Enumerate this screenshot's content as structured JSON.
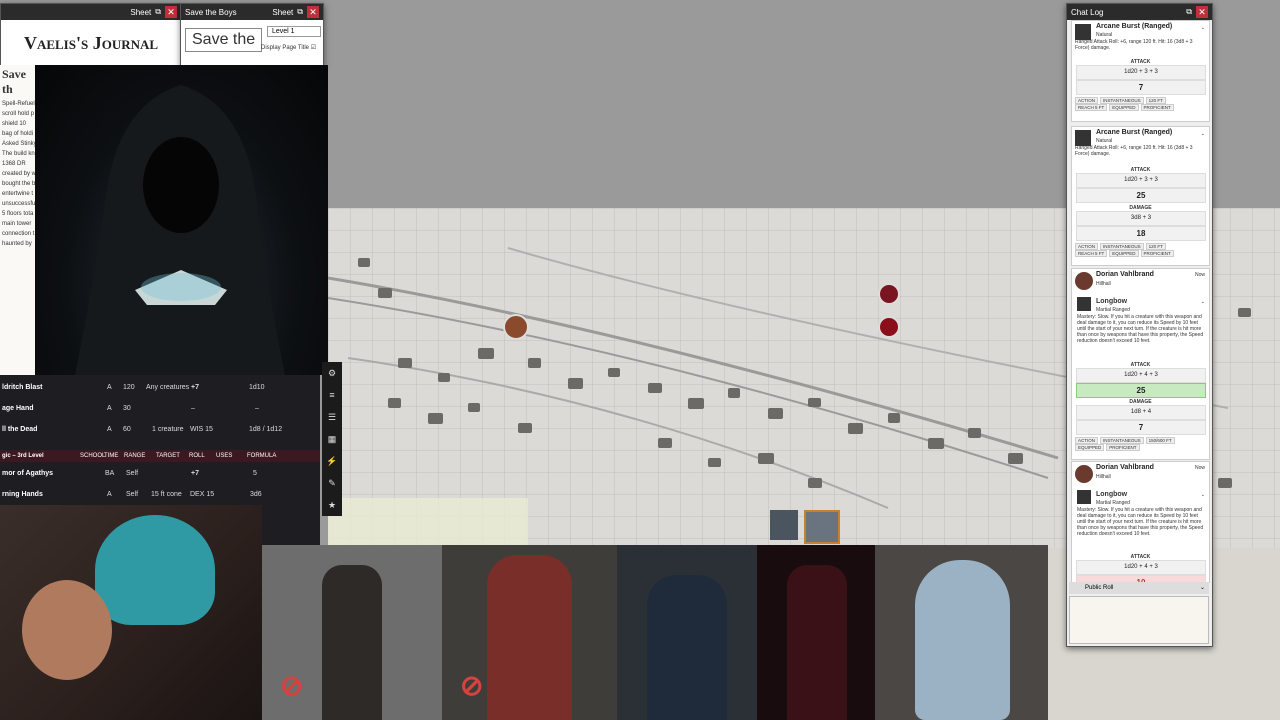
{
  "journal": {
    "sheet_label": "Sheet",
    "title": "Vaelis's Journal",
    "heading": "Save th",
    "lines": [
      "Spell-Refuel",
      "scroll hold p",
      "shield 10",
      "bag of holdi",
      "Asked Stinky",
      "The build kn",
      "1368 DR",
      "created by w",
      "bought the b",
      "entertwine t",
      "unsuccessfu",
      "5 floors tota",
      "main tower",
      "connection t",
      "haunted by"
    ]
  },
  "save_window": {
    "title": "Save the Boys",
    "sheet_label": "Sheet",
    "page_title": "Save the",
    "level_option": "Level 1",
    "display_page_title": "Display Page Title"
  },
  "spells": {
    "rows": [
      {
        "name": "ldritch Blast",
        "time": "A",
        "range": "120",
        "target": "Any creatures",
        "roll": "+7",
        "formula": "1d10"
      },
      {
        "name": "age Hand",
        "time": "A",
        "range": "30",
        "target": "",
        "roll": "–",
        "formula": "–"
      },
      {
        "name": "ll the Dead",
        "time": "A",
        "range": "60",
        "target": "1 creature",
        "roll": "WIS 15",
        "formula": "1d8 / 1d12"
      }
    ],
    "group_label": "gic – 3rd Level",
    "group_cols": {
      "school": "SCHOOL",
      "time": "TIME",
      "range": "RANGE",
      "target": "TARGET",
      "roll": "ROLL",
      "uses": "USES",
      "formula": "FORMULA"
    },
    "group_rows": [
      {
        "name": "mor of Agathys",
        "time": "BA",
        "range": "Self",
        "target": "",
        "roll": "+7",
        "formula": "5"
      },
      {
        "name": "rning Hands",
        "time": "A",
        "range": "Self",
        "target": "15 ft cone",
        "roll": "DEX 15",
        "formula": "3d6"
      }
    ]
  },
  "chat": {
    "title": "Chat Log",
    "cards": [
      {
        "name": "Arcane Burst (Ranged)",
        "sub": "Natural",
        "desc": "Ranged Attack Roll: +6, range 120 ft. Hit: 16 (3d8 + 3 Force) damage.",
        "attack_label": "ATTACK",
        "attack_formula": "1d20 + 3 + 3",
        "attack_total": "7",
        "tags": [
          "ACTION",
          "INSTANTANEOUS",
          "120 FT",
          "REACH 5 FT",
          "EQUIPPED",
          "PROFICIENT"
        ]
      },
      {
        "name": "Arcane Burst (Ranged)",
        "sub": "Natural",
        "desc": "Ranged Attack Roll: +6, range 120 ft. Hit: 16 (3d8 + 3 Force) damage.",
        "attack_label": "ATTACK",
        "attack_formula": "1d20 + 3 + 3",
        "attack_total": "25",
        "damage_label": "DAMAGE",
        "damage_formula": "3d8 + 3",
        "damage_total": "18",
        "tags": [
          "ACTION",
          "INSTANTANEOUS",
          "120 FT",
          "REACH 5 FT",
          "EQUIPPED",
          "PROFICIENT"
        ]
      },
      {
        "speaker": "Dorian Vahlbrand",
        "speaker_sub": "Hillhall",
        "time": "Now",
        "name": "Longbow",
        "sub": "Martial Ranged",
        "desc": "Mastery: Slow. If you hit a creature with this weapon and deal damage to it, you can reduce its Speed by 10 feet until the start of your next turn. If the creature is hit more than once by weapons that have this property, the Speed reduction doesn't exceed 10 feet.",
        "attack_label": "ATTACK",
        "attack_formula": "1d20 + 4 + 3",
        "attack_total": "25",
        "damage_label": "DAMAGE",
        "damage_formula": "1d8 + 4",
        "damage_total": "7",
        "tags": [
          "ACTION",
          "INSTANTANEOUS",
          "150/600 FT",
          "EQUIPPED",
          "PROFICIENT"
        ]
      },
      {
        "speaker": "Dorian Vahlbrand",
        "speaker_sub": "Hillhall",
        "time": "Now",
        "name": "Longbow",
        "sub": "Martial Ranged",
        "desc": "Mastery: Slow. If you hit a creature with this weapon and deal damage to it, you can reduce its Speed by 10 feet until the start of your next turn. If the creature is hit more than once by weapons that have this property, the Speed reduction doesn't exceed 10 feet.",
        "attack_label": "ATTACK",
        "attack_formula": "1d20 + 4 + 3",
        "attack_total": "10"
      }
    ],
    "roll_mode": "Public Roll"
  }
}
